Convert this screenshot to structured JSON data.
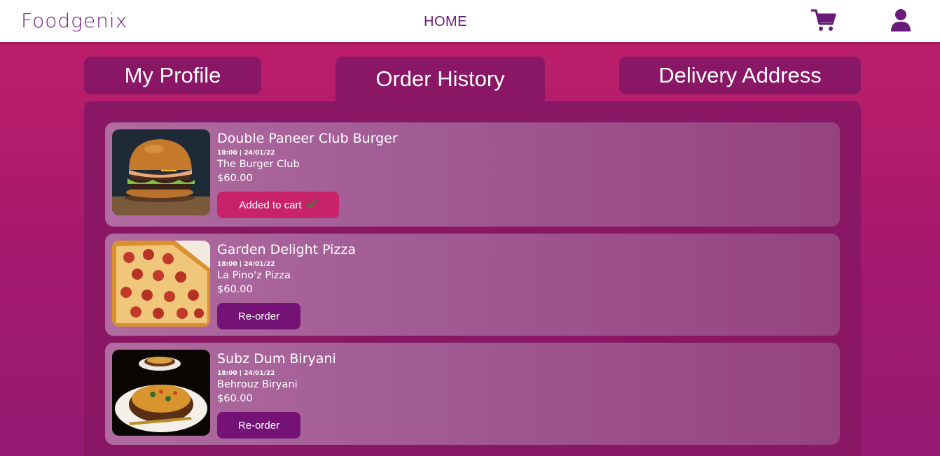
{
  "header": {
    "brand": "Foodgenix",
    "nav_home": "HOME",
    "cart_icon": "shopping-cart",
    "user_icon": "user-profile"
  },
  "tabs": [
    {
      "label": "My Profile",
      "active": false
    },
    {
      "label": "Order History",
      "active": true
    },
    {
      "label": "Delivery Address",
      "active": false
    }
  ],
  "orders": [
    {
      "name": "Double Paneer Club Burger",
      "time": "18:00 | 24/01/22",
      "restaurant": "The Burger Club",
      "price": "$60.00",
      "action": "Added to cart",
      "action_icon": "check-icon",
      "image": "burger"
    },
    {
      "name": "Garden Delight Pizza",
      "time": "18:00 | 24/01/22",
      "restaurant": "La Pino'z Pizza",
      "price": "$60.00",
      "action": "Re-order",
      "image": "pizza"
    },
    {
      "name": "Subz Dum Biryani",
      "time": "18:00 | 24/01/22",
      "restaurant": "Behrouz Biryani",
      "price": "$60.00",
      "action": "Re-order",
      "image": "biryani"
    }
  ],
  "colors": {
    "brand_purple": "#6a1a78",
    "panel": "#891765",
    "added_button": "#c8236a",
    "reorder_button": "#741375",
    "check_green": "#2fae3a"
  }
}
